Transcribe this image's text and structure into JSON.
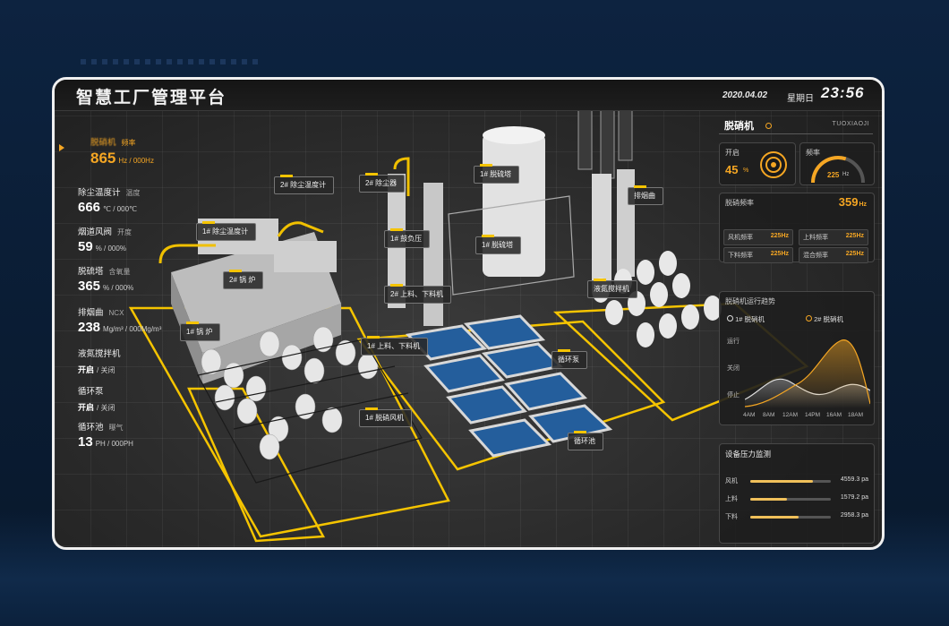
{
  "header": {
    "title": "智慧工厂管理平台",
    "date": "2020.04.02",
    "weekday": "星期日",
    "time": "23:56"
  },
  "left_panel": [
    {
      "title": "脱硝机",
      "sub": "频率",
      "value": "865",
      "unit": "Hz / 000Hz",
      "active": true
    },
    {
      "title": "除尘温度计",
      "sub": "温度",
      "value": "666",
      "unit": "℃ / 000℃"
    },
    {
      "title": "烟道风阀",
      "sub": "开度",
      "value": "59",
      "unit": "% / 000%"
    },
    {
      "title": "脱硫塔",
      "sub": "含氧量",
      "value": "365",
      "unit": "% / 000%"
    },
    {
      "title": "排烟曲",
      "sub": "NCX",
      "value": "238",
      "unit": "Mg/m³ / 000Mg/m³"
    },
    {
      "title": "液氮搅拌机",
      "sub": "",
      "value": "开启",
      "unit": "/ 关闭"
    },
    {
      "title": "循环泵",
      "sub": "",
      "value": "开启",
      "unit": "/ 关闭"
    },
    {
      "title": "循环池",
      "sub": "曝气",
      "value": "13",
      "unit": "PH / 000PH"
    }
  ],
  "scene_labels": [
    "2# 除尘温度计",
    "2# 除尘器",
    "1# 脱硫塔",
    "排烟曲",
    "1# 除尘温度计",
    "1# 鼓负压",
    "1# 脱硫塔",
    "2# 锅 炉",
    "2# 上料、下料机",
    "液氮搅拌机",
    "1# 锅 炉",
    "1# 上料、下料机",
    "循环泵",
    "1# 脱硝风机",
    "循环池"
  ],
  "right_panel": {
    "title": "脱硝机",
    "subtitle": "TUOXIAOJI",
    "switch": {
      "label": "开启",
      "value": "45",
      "unit": "%"
    },
    "gauge": {
      "label": "频率",
      "value": "225",
      "unit": "Hz",
      "level": 0.6
    },
    "freq": {
      "label": "脱硝频率",
      "value": "359",
      "unit": "Hz"
    },
    "mini": [
      {
        "name": "风机频率",
        "value": "225Hz"
      },
      {
        "name": "上料频率",
        "value": "225Hz"
      },
      {
        "name": "下料频率",
        "value": "225Hz"
      },
      {
        "name": "混合频率",
        "value": "225Hz"
      }
    ],
    "trend": {
      "title": "脱硝机运行趋势",
      "legend": [
        "1# 脱硝机",
        "2# 脱硝机"
      ],
      "ylabels": [
        "运行",
        "关闭",
        "停止"
      ],
      "xlabels": [
        "4AM",
        "8AM",
        "12AM",
        "14PM",
        "16AM",
        "18AM"
      ]
    },
    "pressure": {
      "title": "设备压力监测",
      "rows": [
        {
          "name": "风机",
          "value": "4559.3 pa",
          "level": 0.78
        },
        {
          "name": "上料",
          "value": "1579.2 pa",
          "level": 0.45
        },
        {
          "name": "下料",
          "value": "2958.3 pa",
          "level": 0.6
        }
      ]
    }
  },
  "colors": {
    "accent": "#f5a623",
    "outline": "#f5c400",
    "pool": "#2a6fb8"
  }
}
